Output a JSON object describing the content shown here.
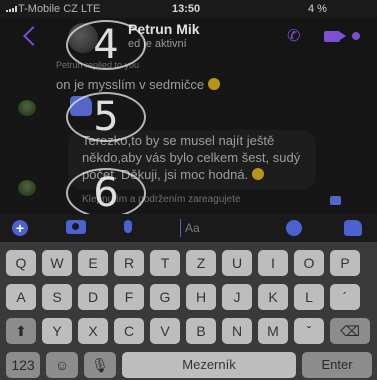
{
  "status_bar": {
    "carrier": "T-Mobile CZ  LTE",
    "time": "13:50",
    "battery": "4 %"
  },
  "header": {
    "name": "Petrun Mik",
    "status": "ed je aktivní"
  },
  "messages": {
    "reply_note": "Petrun replied to you",
    "message1": "on je mysslím v sedmičce",
    "message2": "Terezko,to by se musel najít ještě někdo,aby vás bylo celkem šest, sudý počet. Děkuji, jsi moc hodná.",
    "reaction_note": "Klepnutím a podržením zareagujete"
  },
  "overlay_numbers": [
    "4",
    "5",
    "6"
  ],
  "composer": {
    "placeholder": "Aa"
  },
  "keyboard": {
    "row1": [
      "Q",
      "W",
      "E",
      "R",
      "T",
      "Z",
      "U",
      "I",
      "O",
      "P"
    ],
    "row2": [
      "A",
      "S",
      "D",
      "F",
      "G",
      "H",
      "J",
      "K",
      "L"
    ],
    "row3": [
      "Y",
      "X",
      "C",
      "V",
      "B",
      "N",
      "M"
    ],
    "numbers_key": "123",
    "space_key": "Mezerník",
    "return_key": "Enter",
    "diacritic_key": "ˇ",
    "apostrophe_key": "´"
  },
  "icons": {
    "back": "back-chevron-icon",
    "phone": "phone-icon",
    "video": "video-camera-icon",
    "plus": "plus-icon",
    "camera": "camera-icon",
    "mic": "microphone-icon",
    "emoji": "emoji-icon",
    "like": "thumbs-up-icon"
  },
  "colors": {
    "accent": "#7b4fd6",
    "messenger_blue": "#4b62d0"
  }
}
